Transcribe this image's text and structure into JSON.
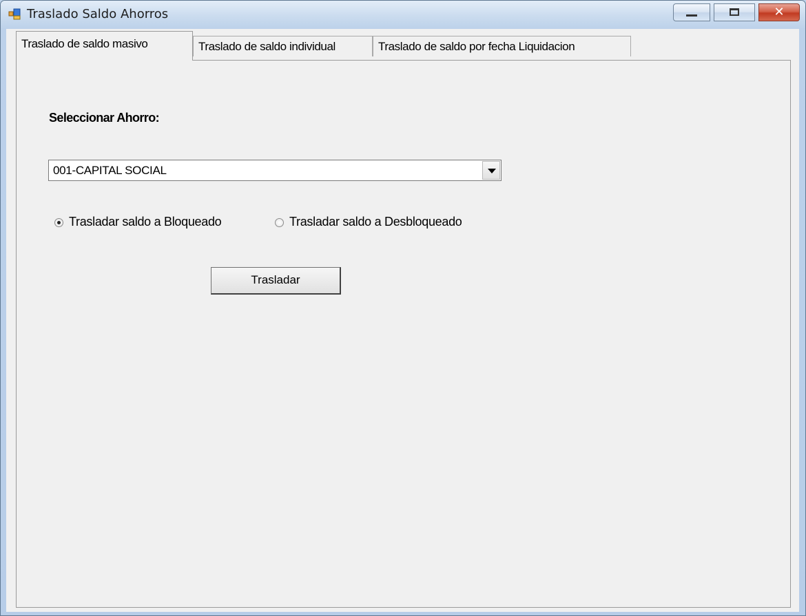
{
  "window": {
    "title": "Traslado Saldo Ahorros",
    "icon": "form-icon",
    "controls": {
      "minimize": "minimize-icon",
      "maximize": "maximize-icon",
      "close_label": "✕"
    }
  },
  "tabs": [
    {
      "label": "Traslado de saldo masivo",
      "active": true
    },
    {
      "label": "Traslado de saldo individual",
      "active": false
    },
    {
      "label": "Traslado de saldo por fecha Liquidacion",
      "active": false
    }
  ],
  "form": {
    "select_label": "Seleccionar Ahorro:",
    "select_value": "001-CAPITAL SOCIAL",
    "radio_options": [
      {
        "label": "Trasladar saldo a Bloqueado",
        "checked": true
      },
      {
        "label": "Trasladar  saldo a Desbloqueado",
        "checked": false
      }
    ],
    "submit_label": "Trasladar"
  }
}
